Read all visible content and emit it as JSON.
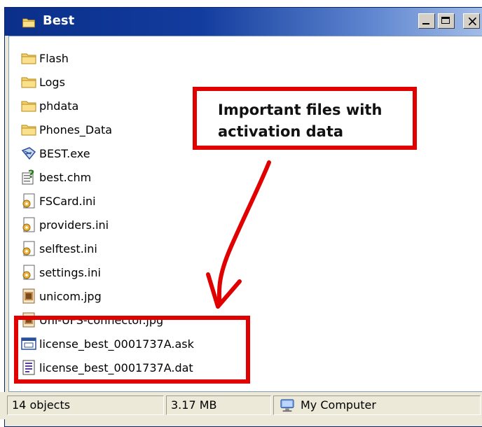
{
  "window": {
    "title": "Best",
    "controls": {
      "minimize": "_",
      "maximize": "□",
      "close": "×"
    }
  },
  "files": [
    {
      "name": "Flash",
      "icon": "folder-icon"
    },
    {
      "name": "Logs",
      "icon": "folder-icon"
    },
    {
      "name": "phdata",
      "icon": "folder-icon"
    },
    {
      "name": "Phones_Data",
      "icon": "folder-icon"
    },
    {
      "name": "BEST.exe",
      "icon": "exe-icon"
    },
    {
      "name": "best.chm",
      "icon": "help-icon"
    },
    {
      "name": "FSCard.ini",
      "icon": "ini-icon"
    },
    {
      "name": "providers.ini",
      "icon": "ini-icon"
    },
    {
      "name": "selftest.ini",
      "icon": "ini-icon"
    },
    {
      "name": "settings.ini",
      "icon": "ini-icon"
    },
    {
      "name": "unicom.jpg",
      "icon": "image-icon"
    },
    {
      "name": "Uni-UFS-connector.jpg",
      "icon": "image-icon"
    },
    {
      "name": "license_best_0001737A.ask",
      "icon": "ask-file-icon"
    },
    {
      "name": "license_best_0001737A.dat",
      "icon": "dat-file-icon"
    }
  ],
  "callout": {
    "line1": "Important files with",
    "line2": "activation data"
  },
  "statusbar": {
    "objects": "14 objects",
    "size": "3.17 MB",
    "zone": "My Computer",
    "zone_icon": "my-computer-icon"
  },
  "colors": {
    "highlight_red": "#e00000",
    "title_blue": "#0b2f8a",
    "folder_yellow": "#f5d36a"
  }
}
